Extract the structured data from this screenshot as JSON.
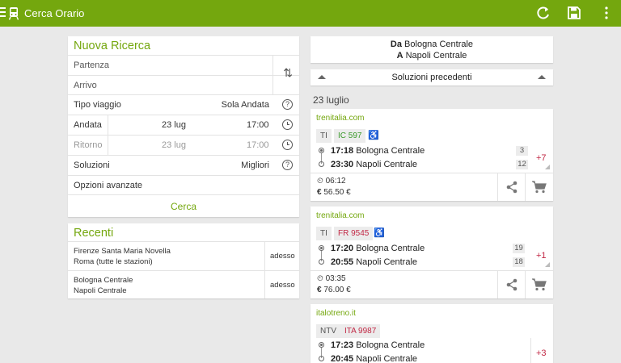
{
  "appbar": {
    "title": "Cerca Orario"
  },
  "search": {
    "title": "Nuova Ricerca",
    "departure_placeholder": "Partenza",
    "arrival_placeholder": "Arrivo",
    "trip_type_label": "Tipo viaggio",
    "trip_type_value": "Sola Andata",
    "outbound_label": "Andata",
    "outbound_date": "23 lug",
    "outbound_time": "17:00",
    "return_label": "Ritorno",
    "return_date": "23 lug",
    "return_time": "17:00",
    "solutions_label": "Soluzioni",
    "solutions_value": "Migliori",
    "advanced_label": "Opzioni avanzate",
    "search_button": "Cerca",
    "help_glyph": "?"
  },
  "recent": {
    "title": "Recenti",
    "items": [
      {
        "from": "Firenze Santa Maria Novella",
        "to": "Roma (tutte le stazioni)",
        "when": "adesso"
      },
      {
        "from": "Bologna Centrale",
        "to": "Napoli Centrale",
        "when": "adesso"
      }
    ]
  },
  "route": {
    "from_prefix": "Da",
    "from": "Bologna Centrale",
    "to_prefix": "A",
    "to": "Napoli Centrale"
  },
  "previous": {
    "label": "Soluzioni precedenti"
  },
  "date_header": "23 luglio",
  "solutions": [
    {
      "operator": "trenitalia.com",
      "category": "TI",
      "train": "IC 597",
      "train_color": "green",
      "dep_time": "17:18",
      "dep_station": "Bologna Centrale",
      "dep_platform": "3",
      "arr_time": "23:30",
      "arr_station": "Napoli Centrale",
      "arr_platform": "12",
      "extra": "+7",
      "duration": "06:12",
      "price": "56.50 €",
      "accessible": true
    },
    {
      "operator": "trenitalia.com",
      "category": "TI",
      "train": "FR 9545",
      "train_color": "red",
      "dep_time": "17:20",
      "dep_station": "Bologna Centrale",
      "dep_platform": "19",
      "arr_time": "20:55",
      "arr_station": "Napoli Centrale",
      "arr_platform": "18",
      "extra": "+1",
      "duration": "03:35",
      "price": "76.00 €",
      "accessible": true
    },
    {
      "operator": "italotreno.it",
      "category": "NTV",
      "train": "ITA 9987",
      "train_color": "red",
      "dep_time": "17:23",
      "dep_station": "Bologna Centrale",
      "arr_time": "20:45",
      "arr_station": "Napoli Centrale",
      "extra": "+3"
    }
  ],
  "symbols": {
    "accessible": "♿",
    "euro": "€",
    "swap": "⇅"
  }
}
